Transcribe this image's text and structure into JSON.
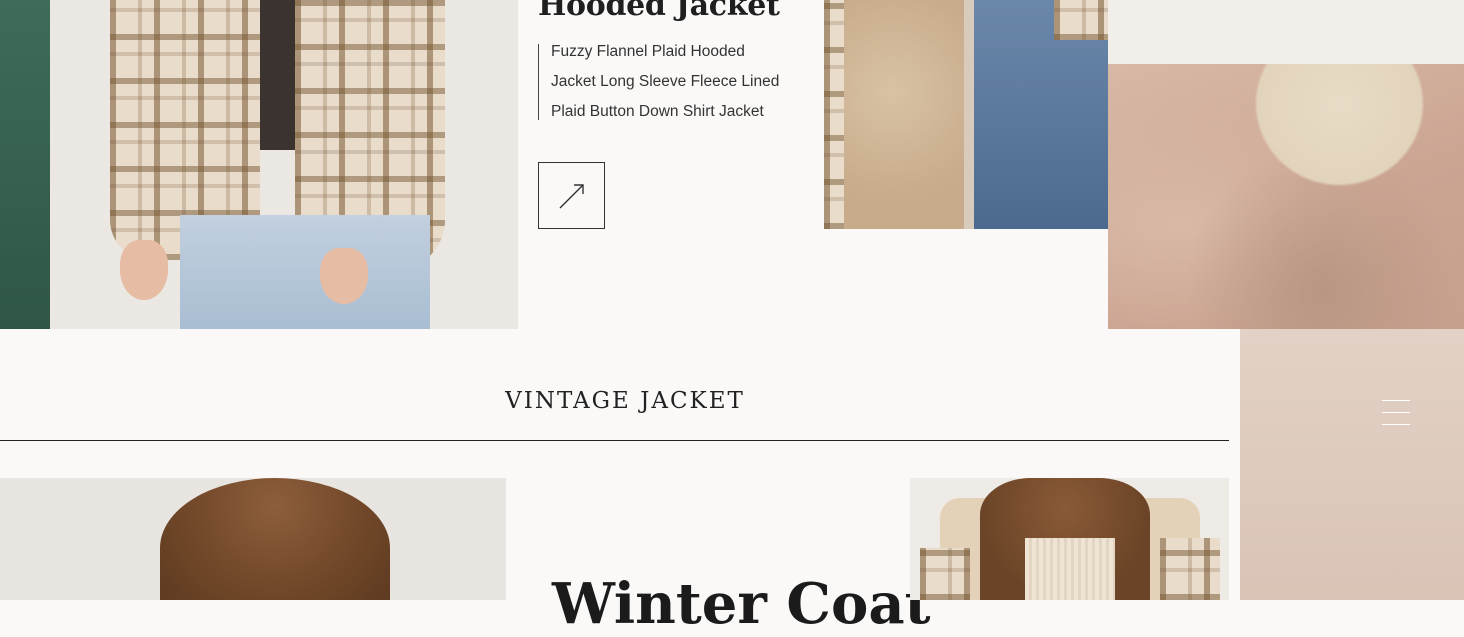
{
  "product": {
    "title": "Hooded Jacket",
    "description_lines": [
      "Fuzzy Flannel Plaid Hooded",
      "Jacket Long Sleeve Fleece Lined",
      "Plaid Button Down Shirt Jacket"
    ],
    "arrow_icon": "arrow-up-right-icon"
  },
  "section": {
    "title": "VINTAGE JACKET"
  },
  "nav": {
    "menu_icon": "hamburger-menu-icon"
  },
  "feature": {
    "title": "Winter Coat"
  },
  "colors": {
    "accent_green": "#2f5647",
    "text_dark": "#1f1f1f",
    "background": "#faf9f8",
    "panel_pink": "#dcc8bc"
  }
}
